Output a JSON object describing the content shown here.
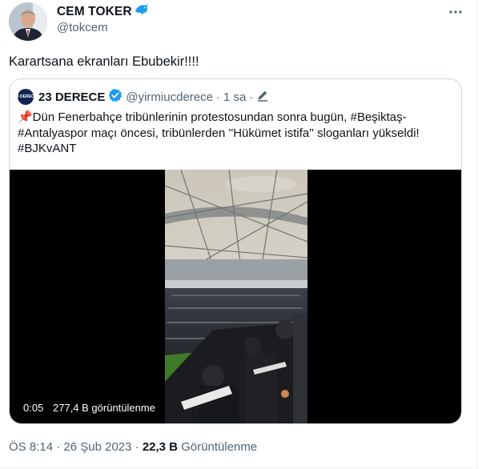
{
  "tweet": {
    "author": {
      "name": "CEM TOKER",
      "handle": "@tokcem",
      "badge_emoji": "dolphin-icon"
    },
    "text": "Karartsana ekranları Ebubekir!!!!",
    "menu_icon": "more-icon"
  },
  "quote": {
    "avatar_text": "23 DERECE",
    "name": "23 DERECE",
    "handle": "@yirmiucderece",
    "separator": "·",
    "time": "1 sa",
    "text": "📌Dün Fenerbahçe tribünlerinin protestosundan sonra bugün, #Beşiktaş-#Antalyaspor maçı öncesi, tribünlerden ''Hükümet istifa'' sloganları yükseldi! #BJKvANT",
    "video": {
      "duration": "0:05",
      "views": "277,4 B görüntülenme"
    }
  },
  "meta": {
    "time": "ÖS 8:14",
    "separator": "·",
    "date": "26 Şub 2023",
    "views_count": "22,3 B",
    "views_label": "Görüntülenme"
  },
  "colors": {
    "verified": "#1d9bf0",
    "secondary_text": "#536471",
    "border": "#cfd9de"
  }
}
